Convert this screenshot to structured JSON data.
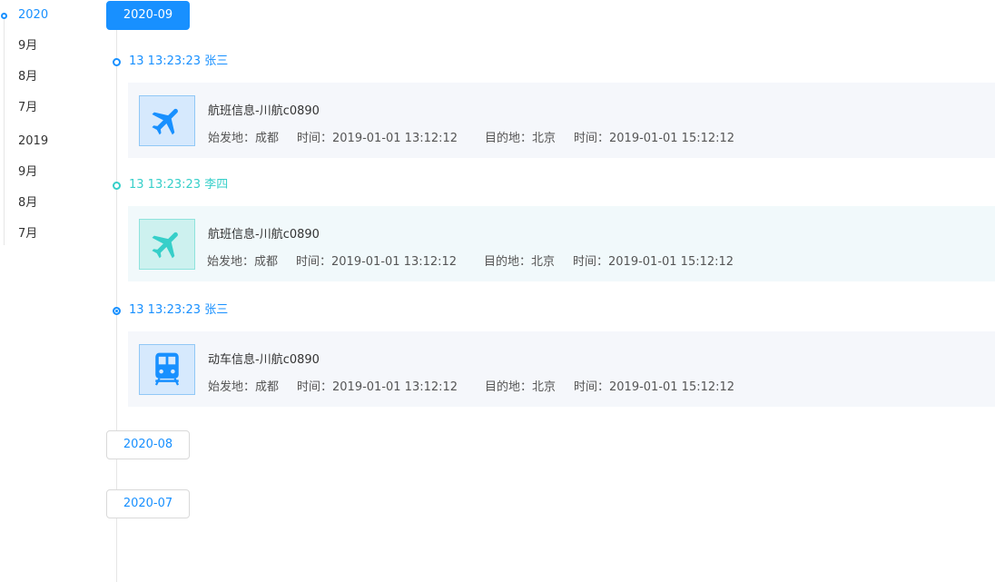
{
  "year_nav": {
    "items": [
      {
        "label": "2020",
        "active": true
      },
      {
        "label": "9月"
      },
      {
        "label": "8月"
      },
      {
        "label": "7月"
      },
      {
        "label": "2019"
      },
      {
        "label": "9月"
      },
      {
        "label": "8月"
      },
      {
        "label": "7月"
      }
    ]
  },
  "timeline": {
    "months": [
      {
        "label": "2020-09",
        "active": true
      },
      {
        "label": "2020-08"
      },
      {
        "label": "2020-07"
      }
    ],
    "entries": [
      {
        "head": "13 13:23:23 张三",
        "icon": "airplane-icon",
        "title": "航班信息-川航c0890",
        "origin": "始发地：成都",
        "depart_time": "时间：2019-01-01 13:12:12",
        "destination": "目的地：北京",
        "arrive_time": "时间：2019-01-01 15:12:12"
      },
      {
        "head": "13 13:23:23 李四",
        "icon": "airplane-icon",
        "title": "航班信息-川航c0890",
        "origin": "始发地：成都",
        "depart_time": "时间：2019-01-01 13:12:12",
        "destination": "目的地：北京",
        "arrive_time": "时间：2019-01-01 15:12:12"
      },
      {
        "head": "13 13:23:23 张三",
        "icon": "train-icon",
        "title": "动车信息-川航c0890",
        "origin": "始发地：成都",
        "depart_time": "时间：2019-01-01 13:12:12",
        "destination": "目的地：北京",
        "arrive_time": "时间：2019-01-01 15:12:12"
      }
    ]
  },
  "colors": {
    "accent": "#1890ff",
    "teal": "#36cfc9"
  }
}
